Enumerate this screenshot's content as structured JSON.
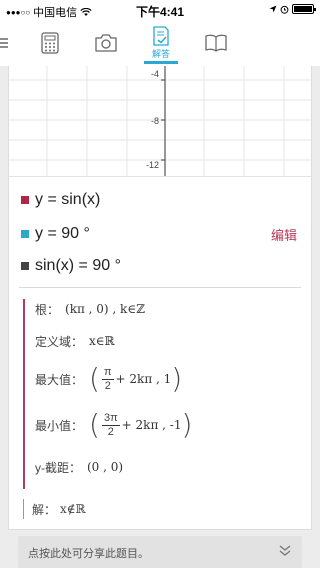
{
  "status_bar": {
    "carrier": "中国电信",
    "time": "下午4:41"
  },
  "toolbar": {
    "items": [
      {
        "icon": "menu-icon"
      },
      {
        "icon": "calculator-icon"
      },
      {
        "icon": "camera-icon"
      },
      {
        "icon": "solve-icon",
        "label": "解答",
        "active": true
      },
      {
        "icon": "book-icon"
      }
    ]
  },
  "graph": {
    "y_ticks": [
      "-4",
      "-8",
      "-12"
    ]
  },
  "expressions": [
    {
      "text": "y = sin(x)",
      "color": "#b1254b"
    },
    {
      "text": "y = 90 °",
      "color": "#2aa9c9"
    },
    {
      "text": "sin(x) = 90 °",
      "color": "#444444"
    }
  ],
  "edit_label": "编辑",
  "results": {
    "roots_label": "根：",
    "roots_value": "(kπ , 0) , k∈ℤ",
    "domain_label": "定义域：",
    "domain_value": "x∈ℝ",
    "max_label": "最大值：",
    "max_num": "π",
    "max_den": "2",
    "max_rest": "+ 2kπ , 1",
    "min_label": "最小值：",
    "min_num": "3π",
    "min_den": "2",
    "min_rest": "+ 2kπ , -1",
    "yint_label": "y-截距：",
    "yint_value": "(0 , 0)"
  },
  "solution": {
    "label": "解：",
    "value": "x∉ℝ"
  },
  "share_bar": {
    "text": "点按此处可分享此题目。"
  }
}
